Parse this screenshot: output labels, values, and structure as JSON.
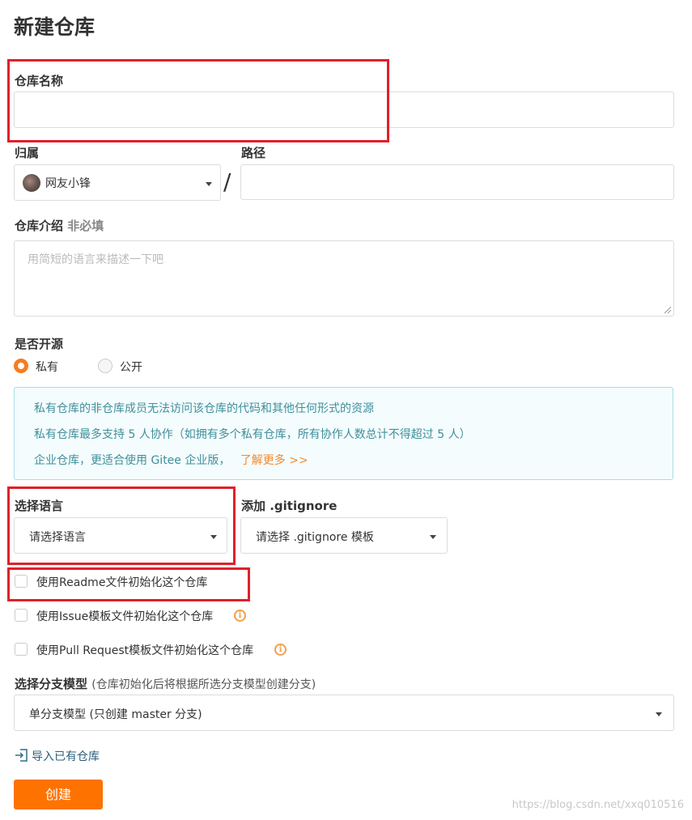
{
  "page": {
    "title": "新建仓库"
  },
  "repo_name": {
    "label": "仓库名称",
    "value": ""
  },
  "owner": {
    "label": "归属",
    "selected": "网友小锋"
  },
  "path": {
    "label": "路径",
    "separator": "/",
    "value": ""
  },
  "intro": {
    "label": "仓库介绍",
    "optional": "非必填",
    "placeholder": "用简短的语言来描述一下吧"
  },
  "visibility": {
    "label": "是否开源",
    "options": [
      {
        "label": "私有",
        "selected": true
      },
      {
        "label": "公开",
        "selected": false
      }
    ]
  },
  "notice": {
    "lines": [
      "私有仓库的非仓库成员无法访问该仓库的代码和其他任何形式的资源",
      "私有仓库最多支持 5 人协作（如拥有多个私有仓库，所有协作人数总计不得超过 5 人）",
      "企业仓库，更适合使用 Gitee 企业版，"
    ],
    "link": "了解更多 >>"
  },
  "language": {
    "label": "选择语言",
    "selected": "请选择语言"
  },
  "gitignore": {
    "label": "添加 .gitignore",
    "selected": "请选择 .gitignore 模板"
  },
  "checkboxes": [
    {
      "label": "使用Readme文件初始化这个仓库",
      "checked": false
    },
    {
      "label": "使用Issue模板文件初始化这个仓库",
      "checked": false,
      "info_icon": "info-icon"
    },
    {
      "label": "使用Pull Request模板文件初始化这个仓库",
      "checked": false,
      "info_icon": "info-icon"
    }
  ],
  "branch_model": {
    "label": "选择分支模型",
    "note": "(仓库初始化后将根据所选分支模型创建分支)",
    "selected": "单分支模型 (只创建 master 分支)"
  },
  "import_link": {
    "icon": "import-icon",
    "label": "导入已有仓库"
  },
  "create_button": {
    "label": "创建"
  },
  "watermark": "https://blog.csdn.net/xxq010516",
  "colors": {
    "accent": "#fe7300",
    "annotation_red": "#e0202a",
    "notice_text": "#3f8f9c",
    "notice_bg": "#f4fcfd",
    "link_orange": "#f5892d"
  }
}
